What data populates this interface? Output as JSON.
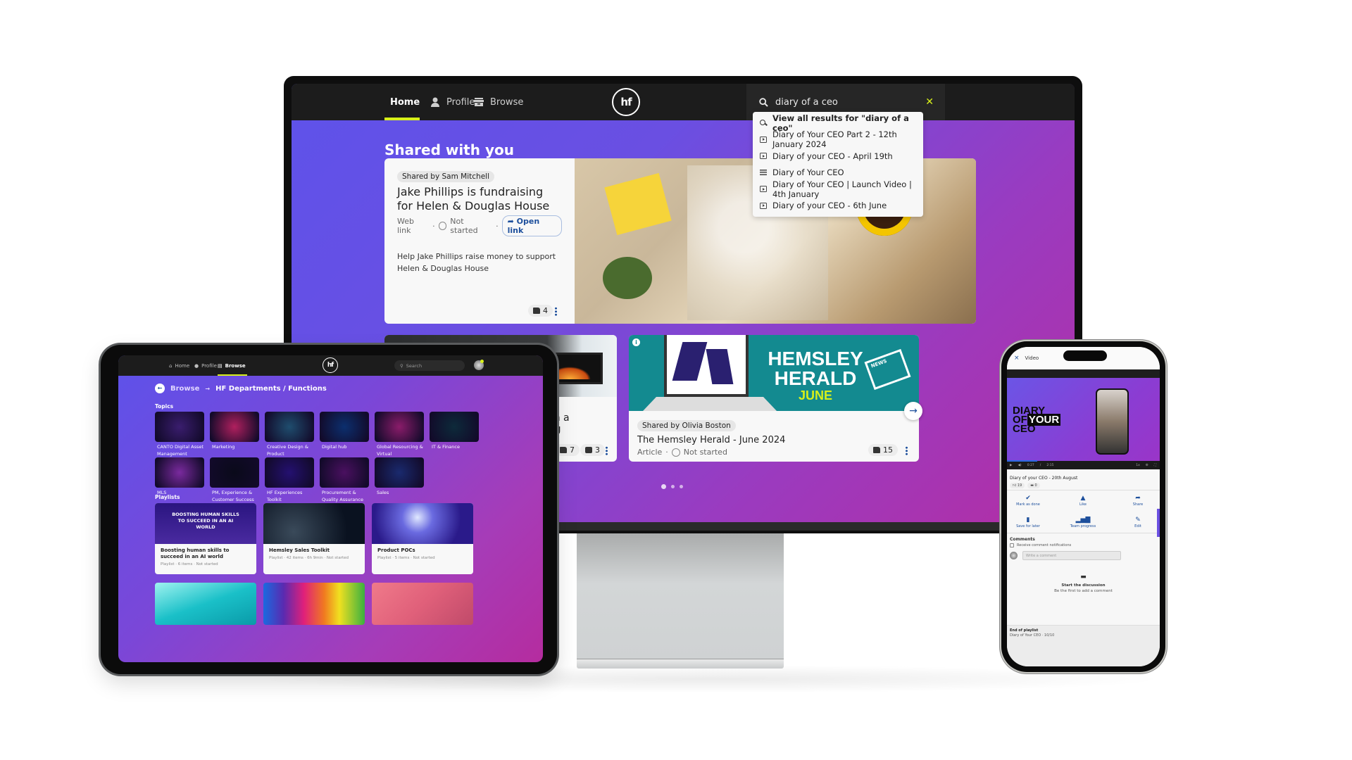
{
  "desktop": {
    "nav": {
      "items": [
        {
          "label": "Home",
          "icon": "home-icon",
          "active": true
        },
        {
          "label": "Profile",
          "icon": "person-icon",
          "active": false
        },
        {
          "label": "Browse",
          "icon": "archive-box-icon",
          "active": false
        }
      ],
      "logo_text": "hf",
      "search": {
        "value": "diary of a ceo",
        "clear_icon": "close-icon"
      },
      "suggestions": [
        {
          "label": "View all results for \"diary of a ceo\"",
          "icon": "search-icon",
          "bold": true
        },
        {
          "label": "Diary of Your CEO Part 2 - 12th January 2024",
          "icon": "video-icon"
        },
        {
          "label": "Diary of your CEO - April 19th",
          "icon": "video-icon"
        },
        {
          "label": "Diary of Your CEO",
          "icon": "playlist-icon"
        },
        {
          "label": "Diary of Your CEO | Launch Video | 4th January",
          "icon": "video-icon"
        },
        {
          "label": "Diary of your CEO - 6th June",
          "icon": "video-icon"
        }
      ]
    },
    "section_title": "Shared with you",
    "featured": {
      "shared_by": "Shared by Sam Mitchell",
      "title": "Jake Phillips is fundraising for Helen & Douglas House",
      "type": "Web link",
      "status": "Not started",
      "open_link": "Open link",
      "description": "Help Jake Phillips raise money to support Helen & Douglas House",
      "likes": "4"
    },
    "cards": [
      {
        "title_fragment": "rtainty in a changing",
        "likes": "7",
        "comments": "3"
      },
      {
        "shared_by": "Shared by Olivia Boston",
        "title": "The Hemsley Herald - June 2024",
        "type": "Article",
        "status": "Not started",
        "likes": "15",
        "banner": {
          "line1": "HEMSLEY",
          "line2": "HERALD",
          "line3": "JUNE",
          "badge": "NEWS"
        }
      }
    ],
    "carousel": {
      "pages": 3,
      "current": 1
    }
  },
  "tablet": {
    "nav": {
      "items": [
        {
          "label": "Home",
          "active": false
        },
        {
          "label": "Profile",
          "active": false
        },
        {
          "label": "Browse",
          "active": true
        }
      ],
      "logo_text": "hf",
      "search_placeholder": "Search"
    },
    "breadcrumb": {
      "root": "Browse",
      "arrow": "→",
      "current": "HF Departments / Functions"
    },
    "topics_title": "Topics",
    "topics": [
      {
        "label": "CANTO Digital Asset Management Platform",
        "color": "#3a1d6e"
      },
      {
        "label": "Marketing",
        "color": "#b0205e"
      },
      {
        "label": "Creative Design & Product",
        "color": "#1f4d6e"
      },
      {
        "label": "Digital hub",
        "color": "#0c2f6e"
      },
      {
        "label": "Global Resourcing & Virtual",
        "color": "#8a1c6a"
      },
      {
        "label": "IT & Finance",
        "color": "#0d2a3a"
      },
      {
        "label": "MLS",
        "color": "#7a2a9e"
      },
      {
        "label": "PM, Experience & Customer Success",
        "color": "#0a0a1a"
      },
      {
        "label": "HF Experiences Toolkit",
        "color": "#241070"
      },
      {
        "label": "Procurement & Quality Assurance",
        "color": "#4a1060"
      },
      {
        "label": "Sales",
        "color": "#1a2a6e"
      }
    ],
    "playlists_title": "Playlists",
    "playlists": [
      {
        "title": "Boosting human skills to succeed in an AI world",
        "meta": "Playlist · 6 items · Not started",
        "banner": "BOOSTING HUMAN SKILLS TO SUCCEED IN AN AI WORLD"
      },
      {
        "title": "Hemsley Sales Toolkit",
        "meta": "Playlist · 42 items · 6h 9min · Not started"
      },
      {
        "title": "Product POCs",
        "meta": "Playlist · 5 items · Not started"
      }
    ]
  },
  "phone": {
    "header": {
      "close": "×",
      "title": "Video"
    },
    "video": {
      "title_art": [
        "DIARY",
        "OF",
        "YOUR",
        "CEO"
      ],
      "time_current": "0:27",
      "time_total": "2:15",
      "speed": "1x",
      "progress": 0.2
    },
    "title": "Diary of your CEO - 20th August",
    "likes": "19",
    "comments_count": "0",
    "actions": [
      {
        "label": "Mark as done",
        "icon": "check-icon"
      },
      {
        "label": "Like",
        "icon": "thumbs-up-icon"
      },
      {
        "label": "Share",
        "icon": "share-icon"
      },
      {
        "label": "Save for later",
        "icon": "bookmark-icon"
      },
      {
        "label": "Team progress",
        "icon": "bar-chart-icon"
      },
      {
        "label": "Edit",
        "icon": "pencil-icon"
      }
    ],
    "comments_title": "Comments",
    "notify_label": "Receive comment notifications",
    "comment_placeholder": "Write a comment",
    "empty_title": "Start the discussion",
    "empty_sub": "Be the first to add a comment",
    "footer_title": "End of playlist",
    "footer_sub": "Diary of Your CEO · 10/10"
  },
  "colors": {
    "accent": "#d7f01a",
    "link": "#1d4f9c",
    "nav_bg": "#1c1c1c"
  }
}
